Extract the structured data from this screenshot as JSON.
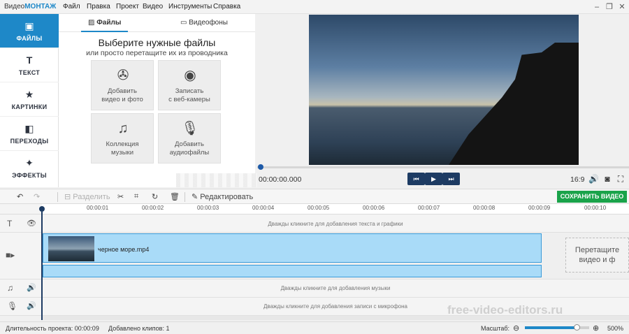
{
  "app": {
    "logo_prefix": "Видео",
    "logo_brand": "МОНТАЖ"
  },
  "menu": [
    "Файл",
    "Правка",
    "Проект",
    "Видео",
    "Инструменты",
    "Справка"
  ],
  "sidebar": {
    "items": [
      {
        "label": "ФАЙЛЫ",
        "icon": "folder-icon"
      },
      {
        "label": "ТЕКСТ",
        "icon": "text-icon"
      },
      {
        "label": "КАРТИНКИ",
        "icon": "star-icon"
      },
      {
        "label": "ПЕРЕХОДЫ",
        "icon": "transitions-icon"
      },
      {
        "label": "ЭФФЕКТЫ",
        "icon": "magic-wand-icon"
      }
    ]
  },
  "panel": {
    "tabs": [
      {
        "label": "Файлы"
      },
      {
        "label": "Видеофоны"
      }
    ],
    "title": "Выберите нужные файлы",
    "subtitle": "или просто перетащите их из проводника",
    "tiles": [
      {
        "line1": "Добавить",
        "line2": "видео и фото"
      },
      {
        "line1": "Записать",
        "line2": "с веб-камеры"
      },
      {
        "line1": "Коллекция",
        "line2": "музыки"
      },
      {
        "line1": "Добавить",
        "line2": "аудиофайлы"
      }
    ]
  },
  "preview": {
    "timecode": "00:00:00.000",
    "ratio": "16:9"
  },
  "toolbar": {
    "split": "Разделить",
    "edit": "Редактировать",
    "save": "СОХРАНИТЬ ВИДЕО"
  },
  "ruler": [
    "00:00:01",
    "00:00:02",
    "00:00:03",
    "00:00:04",
    "00:00:05",
    "00:00:06",
    "00:00:07",
    "00:00:08",
    "00:00:09",
    "00:00:10"
  ],
  "timeline": {
    "text_hint": "Дважды кликните для добавления текста и графики",
    "clip_name": "черное море.mp4",
    "drop_line1": "Перетащите",
    "drop_line2": "видео и ф",
    "music_hint": "Дважды кликните для добавления музыки",
    "mic_hint": "Дважды кликните для добавления записи с микрофона"
  },
  "status": {
    "duration": "Длительность проекта:  00:00:09",
    "clips": "Добавлено клипов: 1",
    "zoom_label": "Масштаб:",
    "zoom_value": "500%",
    "zoom_level": 0.8
  },
  "watermark": "free-video-editors.ru"
}
